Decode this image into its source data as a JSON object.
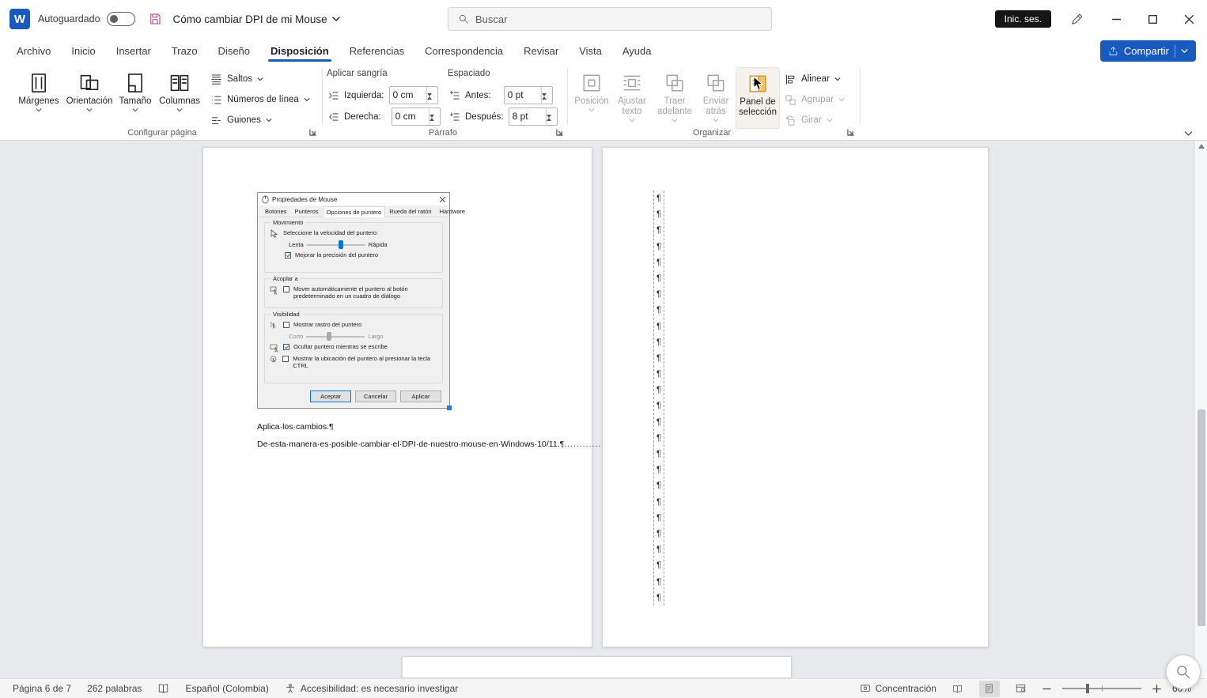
{
  "titlebar": {
    "app_letter": "W",
    "autosave_label": "Autoguardado",
    "autosave_on": false,
    "doc_title": "Cómo cambiar DPI de mi Mouse",
    "search_placeholder": "Buscar",
    "signin_label": "Inic. ses."
  },
  "menubar": {
    "tabs": [
      "Archivo",
      "Inicio",
      "Insertar",
      "Trazo",
      "Diseño",
      "Disposición",
      "Referencias",
      "Correspondencia",
      "Revisar",
      "Vista",
      "Ayuda"
    ],
    "active_tab": "Disposición",
    "share_label": "Compartir"
  },
  "ribbon": {
    "setup": {
      "group_label": "Configurar página",
      "large_buttons": [
        {
          "label": "Márgenes"
        },
        {
          "label": "Orientación"
        },
        {
          "label": "Tamaño"
        },
        {
          "label": "Columnas"
        }
      ],
      "small_buttons": [
        {
          "label": "Saltos"
        },
        {
          "label": "Números de línea"
        },
        {
          "label": "Guiones"
        }
      ]
    },
    "paragraph": {
      "group_label": "Párrafo",
      "indent_header": "Aplicar sangría",
      "spacing_header": "Espaciado",
      "fields": [
        {
          "label": "Izquierda:",
          "value": "0 cm"
        },
        {
          "label": "Derecha:",
          "value": "0 cm"
        },
        {
          "label": "Antes:",
          "value": "0 pt"
        },
        {
          "label": "Después:",
          "value": "8 pt"
        }
      ]
    },
    "arrange": {
      "group_label": "Organizar",
      "large_buttons": [
        {
          "label": "Posición",
          "disabled": true
        },
        {
          "label": "Ajustar texto",
          "disabled": true
        },
        {
          "label": "Traer adelante",
          "disabled": true
        },
        {
          "label": "Enviar atrás",
          "disabled": true
        },
        {
          "label": "Panel de selección",
          "disabled": false
        }
      ],
      "small_buttons": [
        {
          "label": "Alinear",
          "disabled": false
        },
        {
          "label": "Agrupar",
          "disabled": true
        },
        {
          "label": "Girar",
          "disabled": true
        }
      ]
    }
  },
  "document": {
    "page1": {
      "caption1": "Aplica·los·cambios.¶",
      "caption2": "De·esta·manera·es·posible·cambiar·el·DPI·de·nuestro·mouse·en·Windows·10/11.¶",
      "caption2_trailer": "................................"
    },
    "page2": {
      "pilcrow": "¶",
      "pilcrow_count": 26
    }
  },
  "dialog": {
    "title": "Propiedades de Mouse",
    "tabs": [
      "Botones",
      "Punteros",
      "Opciones de puntero",
      "Rueda del ratón",
      "Hardware"
    ],
    "active_tab": "Opciones de puntero",
    "motion": {
      "group_label": "Movimiento",
      "speed_label": "Seleccione la velocidad del puntero:",
      "slow_label": "Lenta",
      "fast_label": "Rápida",
      "precision_label": "Mejorar la precisión del puntero",
      "precision_checked": true
    },
    "snap": {
      "group_label": "Acoplar a",
      "snap_label": "Mover automáticamente el puntero al botón predeterminado en un cuadro de diálogo",
      "snap_checked": false
    },
    "visibility": {
      "group_label": "Visibilidad",
      "trail_label": "Mostrar rastro del puntero",
      "trail_checked": false,
      "short_label": "Corto",
      "long_label": "Largo",
      "hide_label": "Ocultar puntero mientras se escribe",
      "hide_checked": true,
      "ctrl_label": "Mostrar la ubicación del puntero al presionar la tecla CTRL",
      "ctrl_checked": false
    },
    "buttons": [
      "Aceptar",
      "Cancelar",
      "Aplicar"
    ]
  },
  "statusbar": {
    "page_info": "Página 6 de 7",
    "word_count": "262 palabras",
    "language": "Español (Colombia)",
    "accessibility": "Accesibilidad: es necesario investigar",
    "focus_label": "Concentración",
    "zoom_level": "60%"
  },
  "colors": {
    "accent_blue": "#185abd",
    "dialog_accent": "#0078d7",
    "selection_pane_orange": "#f8c15c"
  }
}
